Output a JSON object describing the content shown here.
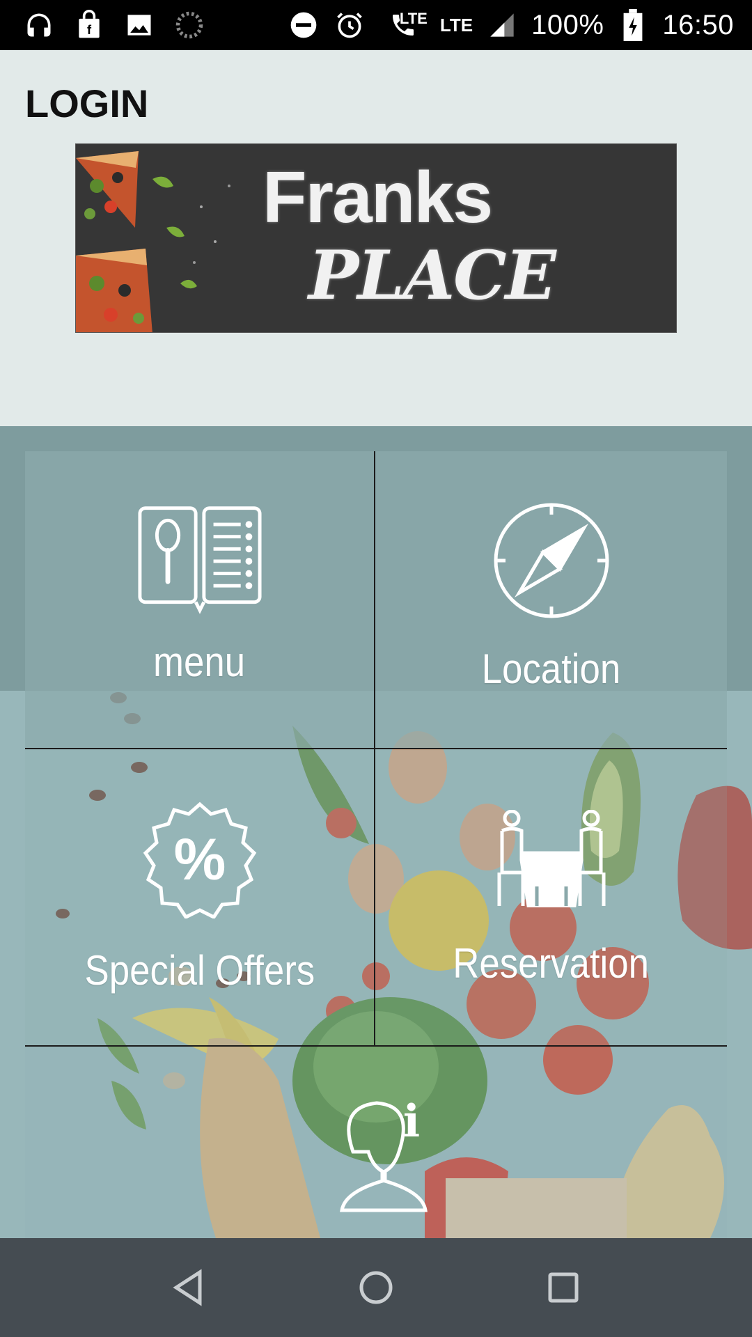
{
  "status_bar": {
    "battery": "100%",
    "time": "16:50",
    "network_1": "LTE",
    "network_2": "LTE",
    "left_icons": [
      "headset-icon",
      "shopping-bag-icon",
      "image-icon",
      "loading-icon"
    ],
    "right_icons": [
      "do-not-disturb-icon",
      "alarm-icon",
      "wifi-call-icon",
      "signal-icon",
      "battery-charging-icon"
    ]
  },
  "header": {
    "login_label": "LOGIN",
    "banner": {
      "line1": "Franks",
      "line2": "PLACE"
    }
  },
  "tiles": [
    {
      "label": "menu",
      "icon": "menu-book-icon"
    },
    {
      "label": "Location",
      "icon": "compass-icon"
    },
    {
      "label": "Special Offers",
      "icon": "discount-badge-icon"
    },
    {
      "label": "Reservation",
      "icon": "table-reservation-icon"
    },
    {
      "label": "",
      "icon": "person-info-icon"
    }
  ],
  "nav_bar": {
    "buttons": [
      "back-icon",
      "home-icon",
      "recents-icon"
    ]
  },
  "colors": {
    "header_bg": "#e2eae9",
    "tile_area_bg": "#7e9c9e",
    "nav_bg": "#454c52",
    "banner_bg": "#363636"
  }
}
